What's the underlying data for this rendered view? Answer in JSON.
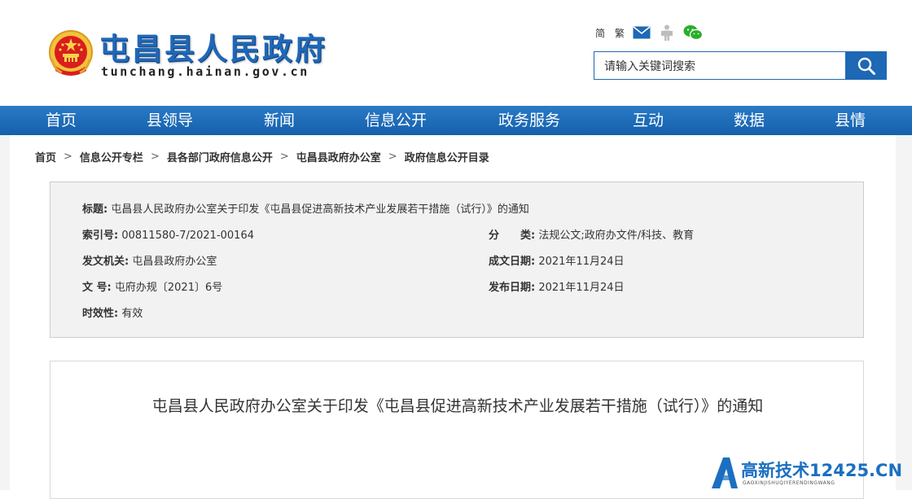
{
  "header": {
    "site_title": "屯昌县人民政府",
    "site_domain": "tunchang.hainan.gov.cn",
    "tools": {
      "simplified": "简",
      "traditional": "繁"
    },
    "search": {
      "placeholder": "请输入关键词搜索"
    }
  },
  "nav": {
    "items": [
      "首页",
      "县领导",
      "新闻",
      "信息公开",
      "政务服务",
      "互动",
      "数据",
      "县情"
    ]
  },
  "breadcrumb": [
    "首页",
    "信息公开专栏",
    "县各部门政府信息公开",
    "屯昌县政府办公室",
    "政府信息公开目录"
  ],
  "breadcrumb_separator": ">",
  "info": {
    "title_label": "标题:",
    "title_value": "屯昌县人民政府办公室关于印发《屯昌县促进高新技术产业发展若干措施（试行）》的通知",
    "index_label": "索引号:",
    "index_value": "00811580-7/2021-00164",
    "category_label": "分　　类:",
    "category_value": "法规公文;政府办文件/科技、教育",
    "issuer_label": "发文机关:",
    "issuer_value": "屯昌县政府办公室",
    "created_label": "成文日期:",
    "created_value": "2021年11月24日",
    "docno_label": "文  号:",
    "docno_value": "屯府办规〔2021〕6号",
    "published_label": "发布日期:",
    "published_value": "2021年11月24日",
    "validity_label": "时效性:",
    "validity_value": "有效"
  },
  "document": {
    "title": "屯昌县人民政府办公室关于印发《屯昌县促进高新技术产业发展若干措施（试行）》的通知"
  },
  "watermark": {
    "text": "高新技术12425.CN",
    "sub": "GAOXINJISHUQIYERENDINGWANG"
  },
  "colors": {
    "brand_blue": "#1e68b5",
    "nav_blue": "#1a66b3",
    "info_bg": "#f2f2f2"
  }
}
